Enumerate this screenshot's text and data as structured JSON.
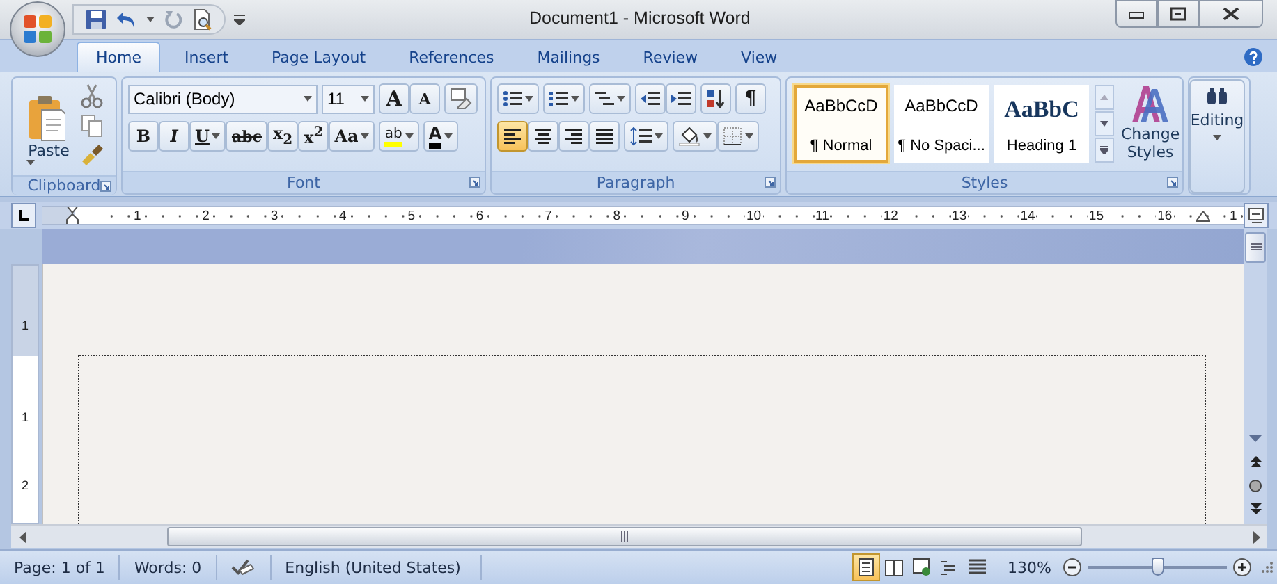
{
  "window": {
    "title": "Document1 - Microsoft Word"
  },
  "tabs": [
    {
      "label": "Home",
      "selected": true
    },
    {
      "label": "Insert",
      "selected": false
    },
    {
      "label": "Page Layout",
      "selected": false
    },
    {
      "label": "References",
      "selected": false
    },
    {
      "label": "Mailings",
      "selected": false
    },
    {
      "label": "Review",
      "selected": false
    },
    {
      "label": "View",
      "selected": false
    }
  ],
  "clipboard": {
    "paste": "Paste",
    "group": "Clipboard"
  },
  "font": {
    "name": "Calibri (Body)",
    "size": "11",
    "grow": "A",
    "shrink": "A",
    "format_buttons": [
      {
        "kind": "bold",
        "label": "B"
      },
      {
        "kind": "italic",
        "label": "I"
      },
      {
        "kind": "underline",
        "label": "U"
      },
      {
        "kind": "strike",
        "label": "abc"
      },
      {
        "kind": "subscript",
        "label": "x$_{2}$"
      },
      {
        "kind": "superscript",
        "label": "x$^{2}$"
      },
      {
        "kind": "case",
        "label": "Aa"
      }
    ],
    "highlight": "ab",
    "font_color_label": "A",
    "group": "Font"
  },
  "paragraph": {
    "pilcrow": "¶",
    "alignment": [
      {
        "kind": "left",
        "selected": true
      },
      {
        "kind": "center",
        "selected": false
      },
      {
        "kind": "right",
        "selected": false
      },
      {
        "kind": "justify",
        "selected": false
      }
    ],
    "group": "Paragraph"
  },
  "styles": {
    "items": [
      {
        "kind": "body",
        "preview": "AaBbCcD",
        "name": "¶ Normal",
        "selected": true
      },
      {
        "kind": "body",
        "preview": "AaBbCcD",
        "name": "¶ No Spaci...",
        "selected": false
      },
      {
        "kind": "heading",
        "preview": "AaBbC",
        "name": "Heading 1",
        "selected": false
      }
    ],
    "change": "Change Styles",
    "group": "Styles"
  },
  "editing": {
    "label": "Editing"
  },
  "ruler": {
    "numbers": [
      "1",
      "2",
      "3",
      "4",
      "5",
      "6",
      "7",
      "8",
      "9",
      "10",
      "11",
      "12",
      "13",
      "14",
      "15",
      "16",
      "1"
    ]
  },
  "vertical_ruler": {
    "numbers": [
      "1",
      "1",
      "2"
    ]
  },
  "status_bar": {
    "page": "Page: 1 of 1",
    "words": "Words: 0",
    "language": "English (United States)",
    "views": [
      {
        "kind": "print",
        "selected": true
      },
      {
        "kind": "reading",
        "selected": false
      },
      {
        "kind": "web",
        "selected": false
      },
      {
        "kind": "outline",
        "selected": false
      },
      {
        "kind": "draft",
        "selected": false
      }
    ],
    "zoom": "130%",
    "zoom_slider": {
      "level": 0.5
    }
  }
}
